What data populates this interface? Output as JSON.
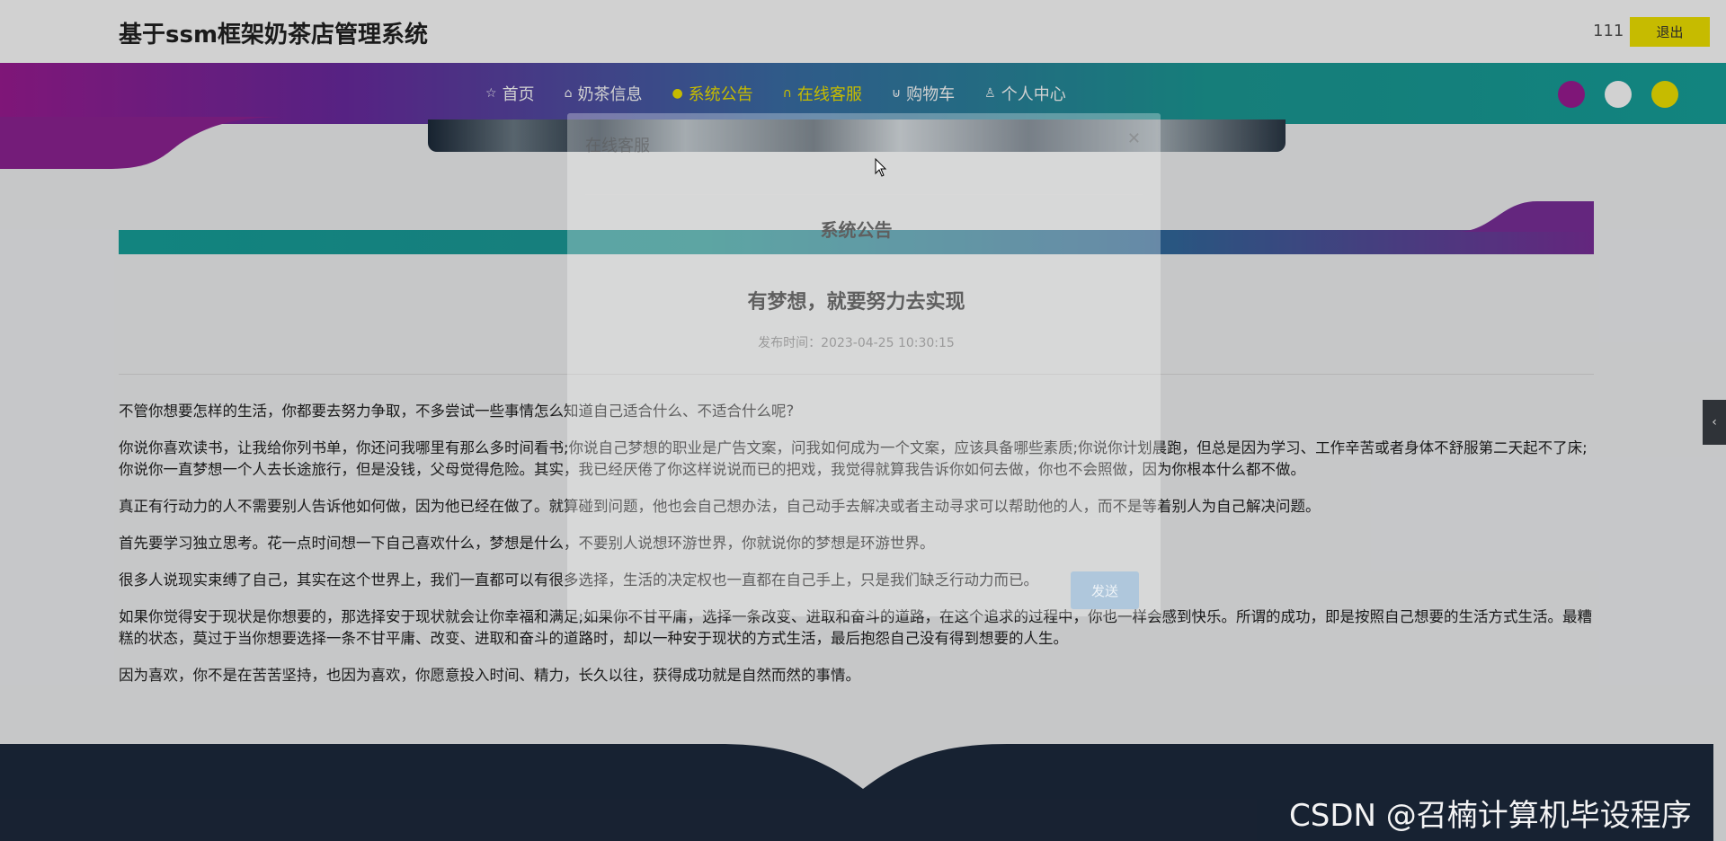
{
  "header": {
    "site_title": "基于ssm框架奶茶店管理系统",
    "user_name": "111",
    "logout_label": "退出"
  },
  "nav": {
    "items": [
      {
        "label": "首页",
        "icon": "star-icon"
      },
      {
        "label": "奶茶信息",
        "icon": "bag-icon"
      },
      {
        "label": "系统公告",
        "icon": "info-icon"
      },
      {
        "label": "在线客服",
        "icon": "headset-icon"
      },
      {
        "label": "购物车",
        "icon": "cart-icon"
      },
      {
        "label": "个人中心",
        "icon": "user-icon"
      }
    ],
    "active_index": 2,
    "theme_colors": [
      "#9b1c93",
      "#ffffff",
      "#f2e500"
    ]
  },
  "section": {
    "title": "系统公告"
  },
  "article": {
    "title": "有梦想，就要努力去实现",
    "date": "发布时间：2023-04-25 10:30:15",
    "paragraphs": [
      "不管你想要怎样的生活，你都要去努力争取，不多尝试一些事情怎么知道自己适合什么、不适合什么呢?",
      "你说你喜欢读书，让我给你列书单，你还问我哪里有那么多时间看书;你说自己梦想的职业是广告文案，问我如何成为一个文案，应该具备哪些素质;你说你计划晨跑，但总是因为学习、工作辛苦或者身体不舒服第二天起不了床;你说你一直梦想一个人去长途旅行，但是没钱，父母觉得危险。其实，我已经厌倦了你这样说说而已的把戏，我觉得就算我告诉你如何去做，你也不会照做，因为你根本什么都不做。",
      "真正有行动力的人不需要别人告诉他如何做，因为他已经在做了。就算碰到问题，他也会自己想办法，自己动手去解决或者主动寻求可以帮助他的人，而不是等着别人为自己解决问题。",
      "首先要学习独立思考。花一点时间想一下自己喜欢什么，梦想是什么，不要别人说想环游世界，你就说你的梦想是环游世界。",
      "很多人说现实束缚了自己，其实在这个世界上，我们一直都可以有很多选择，生活的决定权也一直都在自己手上，只是我们缺乏行动力而已。",
      "如果你觉得安于现状是你想要的，那选择安于现状就会让你幸福和满足;如果你不甘平庸，选择一条改变、进取和奋斗的道路，在这个追求的过程中，你也一样会感到快乐。所谓的成功，即是按照自己想要的生活方式生活。最糟糕的状态，莫过于当你想要选择一条不甘平庸、改变、进取和奋斗的道路时，却以一种安于现状的方式生活，最后抱怨自己没有得到想要的人生。",
      "因为喜欢，你不是在苦苦坚持，也因为喜欢，你愿意投入时间、精力，长久以往，获得成功就是自然而然的事情。"
    ]
  },
  "chat_dialog": {
    "title": "在线客服",
    "close_icon": "close-icon",
    "send_label": "发送"
  },
  "side_tab": {
    "icon": "chevron-left-icon",
    "glyph": "‹"
  },
  "watermark": "CSDN @召楠计算机毕设程序"
}
